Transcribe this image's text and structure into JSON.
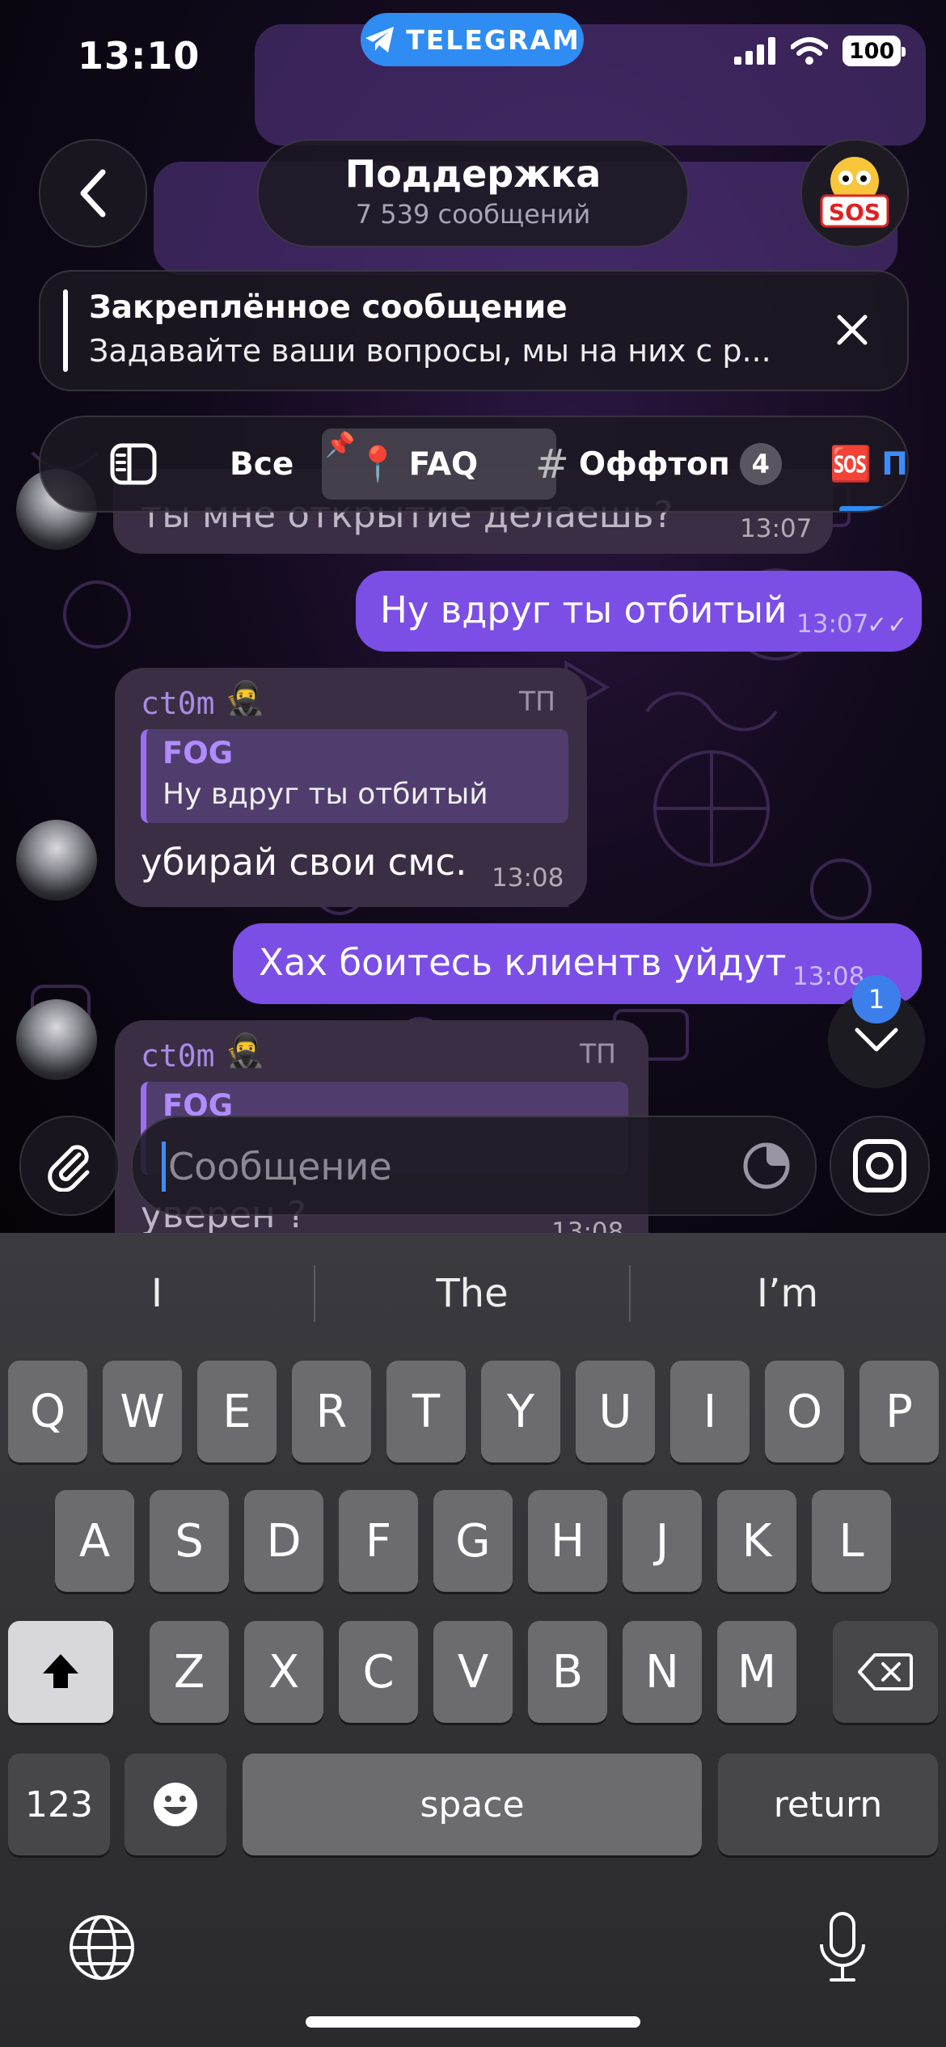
{
  "status_bar": {
    "time": "13:10",
    "app_pill": "TELEGRAM",
    "battery": "100"
  },
  "header": {
    "title": "Поддержка",
    "subtitle": "7 539 сообщений"
  },
  "pinned": {
    "title": "Закреплённое сообщение",
    "text": "Задавайте ваши вопросы, мы на них с р..."
  },
  "topics": {
    "items": [
      {
        "label": "Все"
      },
      {
        "label": "FAQ"
      },
      {
        "label": "Оффтоп",
        "badge": "4"
      },
      {
        "label": "П"
      }
    ]
  },
  "messages": [
    {
      "text": "ты мне открытие делаешь?",
      "time": "13:07"
    },
    {
      "text": "Ну вдруг ты отбитый",
      "time": "13:07"
    },
    {
      "sender": "ct0m",
      "role": "ТП",
      "quote_name": "FOG",
      "quote_text": "Ну вдруг ты отбитый",
      "text": "убирай свои смс.",
      "time": "13:08"
    },
    {
      "text": "Хах боитесь клиентв уйдут",
      "time": "13:08"
    },
    {
      "sender": "ct0m",
      "role": "ТП",
      "quote_name": "FOG",
      "text": "уверен ?",
      "time": "13:08"
    }
  ],
  "scroll_down_badge": "1",
  "composer": {
    "placeholder": "Сообщение"
  },
  "keyboard": {
    "suggestions": [
      "I",
      "The",
      "I’m"
    ],
    "row1": [
      "Q",
      "W",
      "E",
      "R",
      "T",
      "Y",
      "U",
      "I",
      "O",
      "P"
    ],
    "row2": [
      "A",
      "S",
      "D",
      "F",
      "G",
      "H",
      "J",
      "K",
      "L"
    ],
    "row3": [
      "Z",
      "X",
      "C",
      "V",
      "B",
      "N",
      "M"
    ],
    "numbers_key": "123",
    "space_key": "space",
    "return_key": "return"
  },
  "colors": {
    "outgoing_bubble": "#7b4ee6",
    "incoming_bubble": "#3a2e44",
    "accent": "#2f8cf3"
  }
}
